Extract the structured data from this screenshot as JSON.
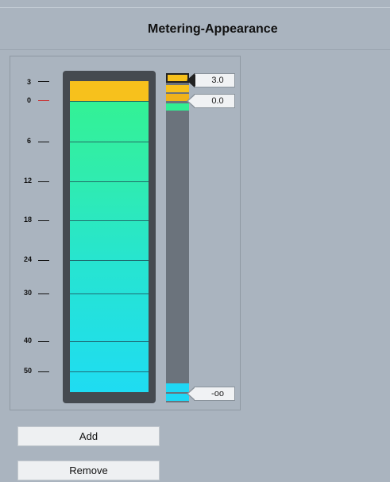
{
  "header": {
    "title": "Metering-Appearance"
  },
  "scale": {
    "labels": [
      "3",
      "0",
      "6",
      "12",
      "18",
      "24",
      "30",
      "40",
      "50"
    ],
    "marker_color_zero": "#cc2a2a"
  },
  "meter": {
    "colors": {
      "yellow": "#f7c11c",
      "green": "#34f38e",
      "cyan": "#1fdcf2",
      "frame": "#454a50"
    }
  },
  "handles": [
    {
      "value": "3.0",
      "color": "#f7c11c",
      "selected": true
    },
    {
      "value": "0.0",
      "color": "#f7c11c",
      "selected": false
    },
    {
      "value": "-oo",
      "color": "#1fd7f5",
      "selected": false
    }
  ],
  "buttons": {
    "add": "Add",
    "remove": "Remove"
  }
}
